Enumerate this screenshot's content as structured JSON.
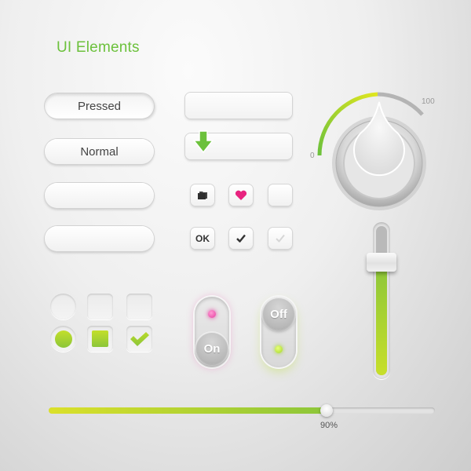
{
  "title": "UI Elements",
  "buttons": {
    "pressed_label": "Pressed",
    "normal_label": "Normal",
    "blank1_label": "",
    "blank2_label": ""
  },
  "rect_inputs": [
    {
      "value": "",
      "icon": "none"
    },
    {
      "value": "",
      "icon": "arrow-down-icon"
    }
  ],
  "icon_buttons": [
    {
      "name": "folder-button",
      "icon": "folder-icon",
      "label": ""
    },
    {
      "name": "heart-button",
      "icon": "heart-icon",
      "label": ""
    },
    {
      "name": "blank-button",
      "icon": "none",
      "label": ""
    },
    {
      "name": "ok-button",
      "icon": "none",
      "label": "OK"
    },
    {
      "name": "check-button",
      "icon": "check-icon",
      "label": ""
    },
    {
      "name": "check-disabled-button",
      "icon": "check-icon",
      "label": ""
    }
  ],
  "selectors": {
    "radio_unchecked": false,
    "square_unchecked": false,
    "checkbox_unchecked": false,
    "radio_checked": true,
    "square_checked": true,
    "checkbox_checked": true
  },
  "toggles": [
    {
      "label": "On",
      "state": "on",
      "led_color": "#e63ca0"
    },
    {
      "label": "Off",
      "state": "off",
      "led_color": "#a4d62a"
    }
  ],
  "knob": {
    "min_label": "0",
    "max_label": "100",
    "value": 50
  },
  "vertical_slider": {
    "value_fraction": 0.75
  },
  "horizontal_slider": {
    "value_percent": 72,
    "label": "90%"
  },
  "colors": {
    "accent": "#8cc63a",
    "accent_light": "#c7df2a",
    "title": "#6cc13c",
    "heart": "#e8237f"
  }
}
